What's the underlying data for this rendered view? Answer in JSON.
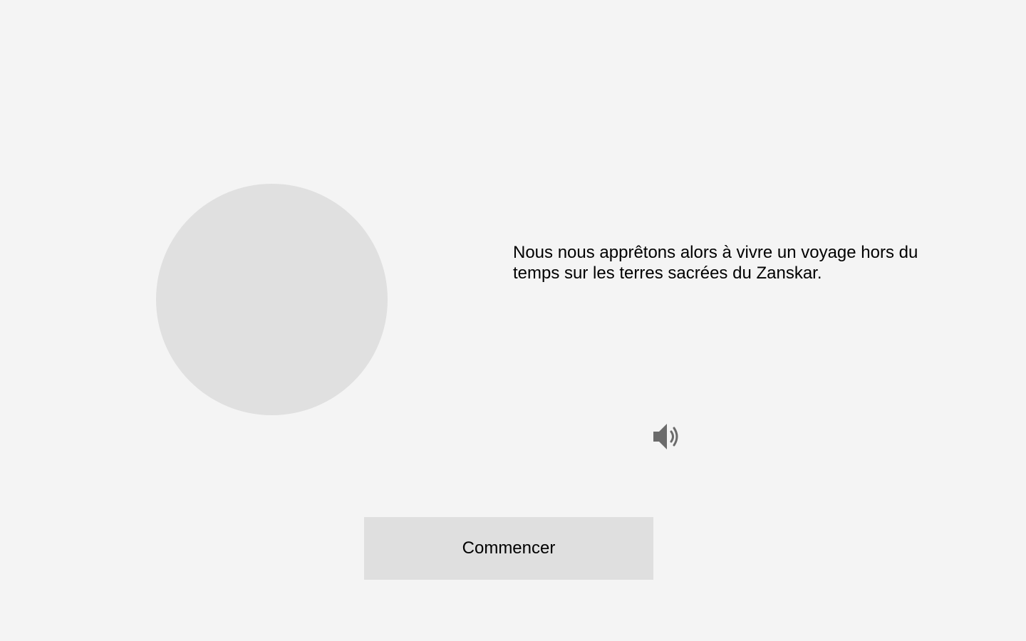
{
  "slide": {
    "narration": "Nous nous apprêtons alors à vivre un voyage hors du temps sur les terres sacrées du Zanskar."
  },
  "audio": {
    "icon": "speaker-volume-icon",
    "color": "#6b6b6b"
  },
  "actions": {
    "start_label": "Commencer"
  },
  "colors": {
    "background": "#f4f4f4",
    "placeholder": "#e0e0e0",
    "button": "#dfdfdf",
    "text": "#000000"
  }
}
